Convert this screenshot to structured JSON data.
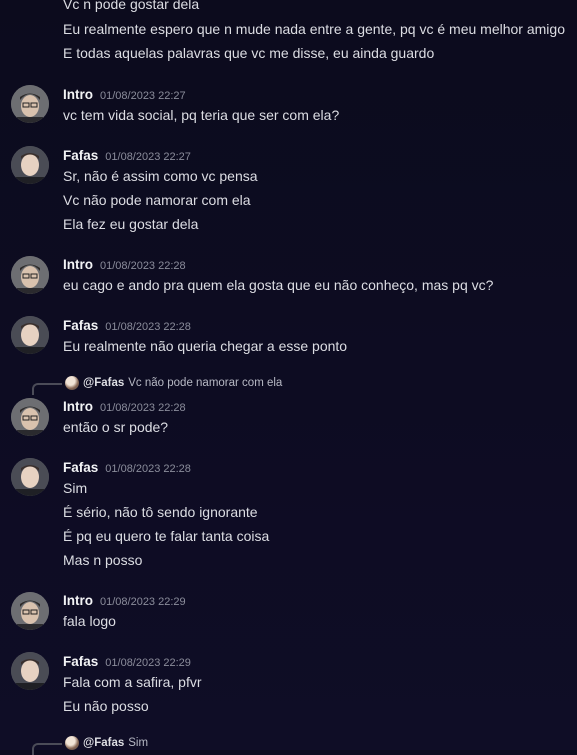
{
  "messages": [
    {
      "lines": [
        "Vc n pode gostar dela",
        "Eu realmente espero que n mude nada entre a gente, pq vc é meu melhor amigo",
        "E todas aquelas palavras que vc me disse, eu ainda guardo"
      ]
    },
    {
      "author": "Intro",
      "timestamp": "01/08/2023 22:27",
      "lines": [
        "vc tem vida social, pq teria que ser com ela?"
      ]
    },
    {
      "author": "Fafas",
      "timestamp": "01/08/2023 22:27",
      "lines": [
        "Sr, não é assim como vc pensa",
        "Vc não pode namorar com ela",
        "Ela fez eu gostar dela"
      ]
    },
    {
      "author": "Intro",
      "timestamp": "01/08/2023 22:28",
      "lines": [
        "eu cago e ando pra quem ela gosta que eu não conheço, mas pq vc?"
      ]
    },
    {
      "author": "Fafas",
      "timestamp": "01/08/2023 22:28",
      "lines": [
        "Eu realmente não queria chegar a esse ponto"
      ]
    },
    {
      "reply": {
        "author": "@Fafas",
        "text": "Vc não pode namorar com ela"
      },
      "author": "Intro",
      "timestamp": "01/08/2023 22:28",
      "lines": [
        "então o sr pode?"
      ]
    },
    {
      "author": "Fafas",
      "timestamp": "01/08/2023 22:28",
      "lines": [
        "Sim",
        "É sério, não tô sendo ignorante",
        "É pq eu quero te falar tanta coisa",
        "Mas n posso"
      ]
    },
    {
      "author": "Intro",
      "timestamp": "01/08/2023 22:29",
      "lines": [
        "fala logo"
      ]
    },
    {
      "author": "Fafas",
      "timestamp": "01/08/2023 22:29",
      "lines": [
        "Fala com a safira, pfvr",
        "Eu não posso"
      ]
    },
    {
      "reply": {
        "author": "@Fafas",
        "text": "Sim"
      }
    }
  ]
}
